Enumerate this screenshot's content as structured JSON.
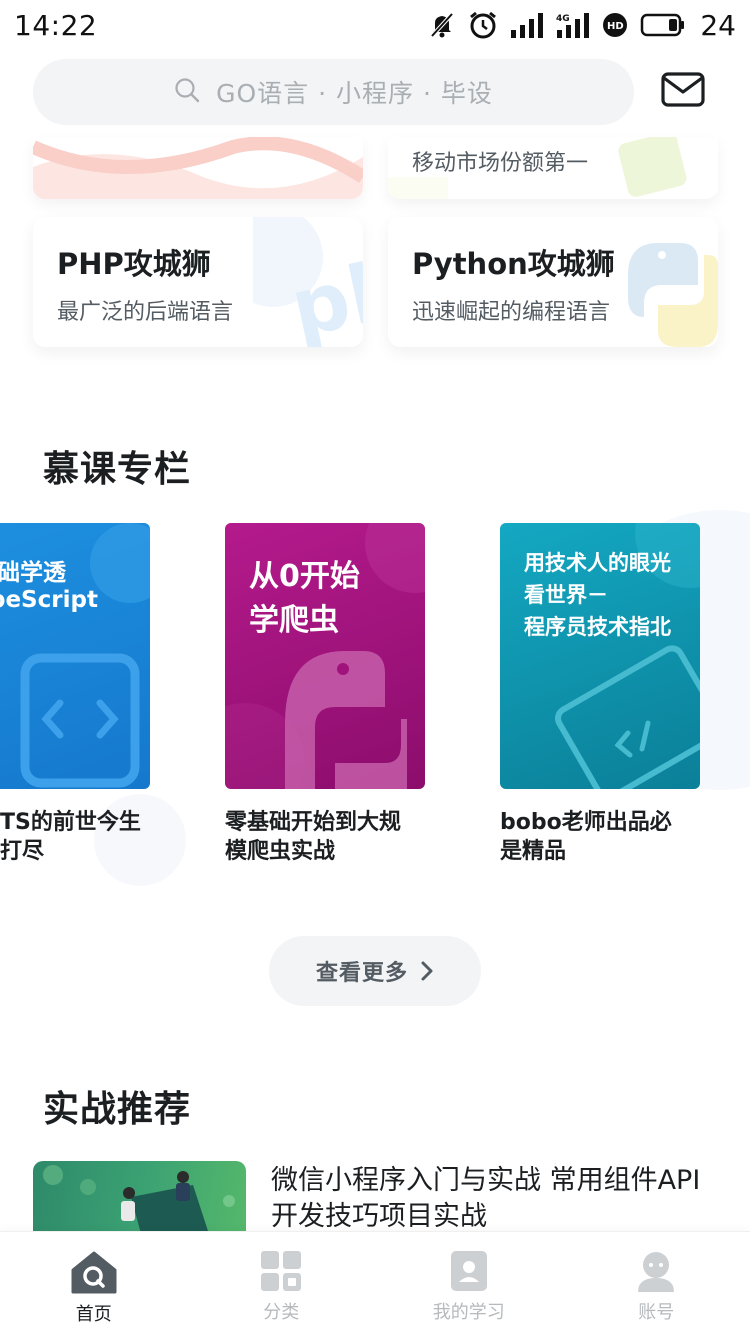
{
  "status_bar": {
    "time": "14:22",
    "battery": "24",
    "icons": [
      "mute-bell-icon",
      "alarm-icon",
      "signal-icon",
      "signal-4g-icon",
      "hd-icon",
      "battery-icon"
    ]
  },
  "search": {
    "placeholder": "GO语言 · 小程序 · 毕设",
    "icon": "search-icon"
  },
  "header": {
    "mail_icon": "mail-icon"
  },
  "categories": {
    "top_right_sub": "移动市场份额第一",
    "cards": [
      {
        "title": "PHP攻城狮",
        "subtitle": "最广泛的后端语言"
      },
      {
        "title": "Python攻城狮",
        "subtitle": "迅速崛起的编程语言"
      }
    ]
  },
  "columns": {
    "title": "慕课专栏",
    "items": [
      {
        "cover_lines": [
          "基础学透",
          "ypeScript"
        ],
        "caption_lines": [
          "TS的前世今生",
          "打尽"
        ],
        "color": "#1a84d6"
      },
      {
        "cover_lines": [
          "从0开始",
          "学爬虫"
        ],
        "caption_lines": [
          "零基础开始到大规",
          "模爬虫实战"
        ],
        "color": "#a0137c"
      },
      {
        "cover_lines": [
          "用技术人的眼光",
          "看世界－",
          "程序员技术指北"
        ],
        "caption_lines": [
          "bobo老师出品必",
          "是精品"
        ],
        "color": "#0e94ad"
      }
    ],
    "view_more": "查看更多"
  },
  "recommend": {
    "title": "实战推荐",
    "course_title": "微信小程序入门与实战 常用组件API开发技巧项目实战"
  },
  "bottom_nav": {
    "items": [
      {
        "label": "首页",
        "icon": "home-icon",
        "active": true
      },
      {
        "label": "分类",
        "icon": "category-grid-icon",
        "active": false
      },
      {
        "label": "我的学习",
        "icon": "my-learning-icon",
        "active": false
      },
      {
        "label": "账号",
        "icon": "account-icon",
        "active": false
      }
    ]
  },
  "colors": {
    "text_primary": "#1c1f21",
    "text_secondary": "#545c63",
    "nav_inactive": "#b6babd",
    "search_bg": "#f3f4f6"
  }
}
